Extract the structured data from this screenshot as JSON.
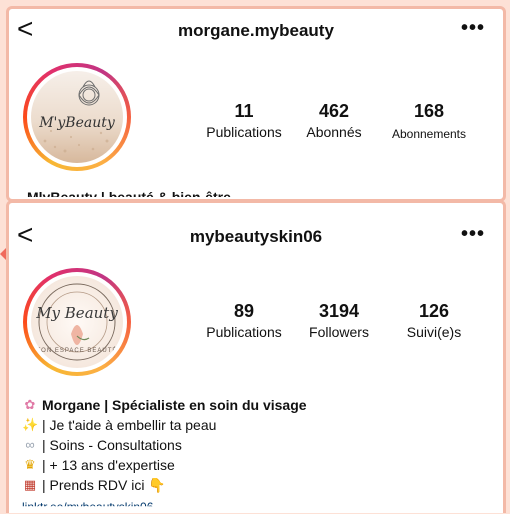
{
  "profile1": {
    "username": "morgane.mybeauty",
    "avatar_text": "M'yBeauty",
    "stats": [
      {
        "value": "11",
        "label": "Publications"
      },
      {
        "value": "462",
        "label": "Abonnés"
      },
      {
        "value": "168",
        "label": "Abonnements"
      }
    ],
    "bio_partial": "MlyBeauty | beauté & bien-être"
  },
  "profile2": {
    "username": "mybeautyskin06",
    "avatar_text": "My Beauty",
    "avatar_ring_text": "TON ESPACE BEAUTÉ",
    "stats": [
      {
        "value": "89",
        "label": "Publications"
      },
      {
        "value": "3194",
        "label": "Followers"
      },
      {
        "value": "126",
        "label": "Suivi(e)s"
      }
    ],
    "bio": [
      {
        "icon": "✿",
        "icon_name": "flower-icon",
        "text": "Morgane | Spécialiste en soin du visage"
      },
      {
        "icon": "✨",
        "icon_name": "sparkles-icon",
        "text": "| Je t'aide à embellir ta peau"
      },
      {
        "icon": "∞",
        "icon_name": "link-rings-icon",
        "text": "| Soins - Consultations"
      },
      {
        "icon": "♛",
        "icon_name": "crown-icon",
        "text": "| + 13 ans d'expertise"
      },
      {
        "icon": "▦",
        "icon_name": "calendar-icon",
        "text": "| Prends RDV ici 👇"
      }
    ],
    "link_partial": "linktr.ee/mybeautyskin06"
  },
  "ui": {
    "back_icon": "‹",
    "more_icon": "•••"
  },
  "colors": {
    "background": "#fde1d6",
    "card_border": "#f3b9a7",
    "accent_arrow": "#f06a5c"
  }
}
